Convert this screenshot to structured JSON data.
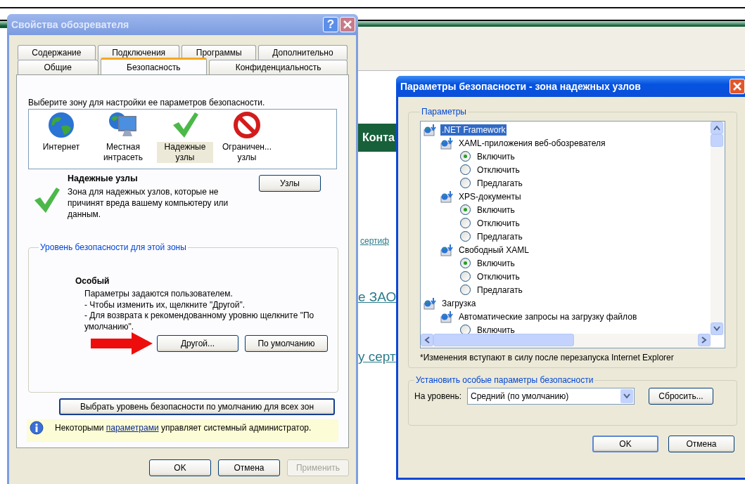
{
  "background_page": {
    "header": "Конта",
    "links": [
      {
        "text": "сертиф",
        "kind": "small"
      },
      {
        "text": "е ЗАО",
        "kind": "large"
      },
      {
        "text": "у серт",
        "kind": "large"
      }
    ]
  },
  "internet_options": {
    "title": "Свойства обозревателя",
    "help_button": "?",
    "tab_rows": [
      [
        {
          "label": "Содержание",
          "selected": false
        },
        {
          "label": "Подключения",
          "selected": false
        },
        {
          "label": "Программы",
          "selected": false
        },
        {
          "label": "Дополнительно",
          "selected": false
        }
      ],
      [
        {
          "label": "Общие",
          "selected": false
        },
        {
          "label": "Безопасность",
          "selected": true
        },
        {
          "label": "Конфиденциальность",
          "selected": false
        }
      ]
    ],
    "zone_prompt": "Выберите зону для настройки ее параметров безопасности.",
    "zones": [
      {
        "kind": "internet",
        "label": "Интернет",
        "selected": false
      },
      {
        "kind": "intranet",
        "label": "Местная интрасеть",
        "selected": false
      },
      {
        "kind": "trusted",
        "label": "Надежные узлы",
        "selected": true
      },
      {
        "kind": "restricted",
        "label": "Ограничен... узлы",
        "selected": false
      }
    ],
    "zone_info": {
      "title": "Надежные узлы",
      "description": "Зона для надежных узлов, которые не причинят вреда вашему компьютеру или данным.",
      "sites_button": "Узлы"
    },
    "level_group": {
      "legend": "Уровень безопасности для этой зоны",
      "level_name": "Особый",
      "lines": [
        "Параметры задаются пользователем.",
        "- Чтобы изменить их, щелкните \"Другой\".",
        "- Для возврата к рекомендованному уровню щелкните \"По умолчанию\"."
      ],
      "custom_button": "Другой...",
      "default_button": "По умолчанию"
    },
    "reset_all_button": "Выбрать уровень безопасности по умолчанию для всех зон",
    "info_bar": {
      "before": "Некоторыми",
      "link": "параметрами",
      "after": "управляет системный администратор."
    },
    "buttons": [
      {
        "label": "OK",
        "disabled": false
      },
      {
        "label": "Отмена",
        "disabled": false
      },
      {
        "label": "Применить",
        "disabled": true
      }
    ]
  },
  "security_settings": {
    "title": "Параметры безопасности - зона надежных узлов",
    "group_legend": "Параметры",
    "tree": [
      {
        "kind": "group",
        "label": ".NET Framework",
        "selected": true,
        "children": [
          {
            "kind": "group",
            "label": "XAML-приложения веб-обозревателя",
            "selected": false,
            "children": [
              {
                "kind": "radio",
                "label": "Включить",
                "checked": true
              },
              {
                "kind": "radio",
                "label": "Отключить",
                "checked": false
              },
              {
                "kind": "radio",
                "label": "Предлагать",
                "checked": false
              }
            ]
          },
          {
            "kind": "group",
            "label": "XPS-документы",
            "selected": false,
            "children": [
              {
                "kind": "radio",
                "label": "Включить",
                "checked": true
              },
              {
                "kind": "radio",
                "label": "Отключить",
                "checked": false
              },
              {
                "kind": "radio",
                "label": "Предлагать",
                "checked": false
              }
            ]
          },
          {
            "kind": "group",
            "label": "Свободный XAML",
            "selected": false,
            "children": [
              {
                "kind": "radio",
                "label": "Включить",
                "checked": true
              },
              {
                "kind": "radio",
                "label": "Отключить",
                "checked": false
              },
              {
                "kind": "radio",
                "label": "Предлагать",
                "checked": false
              }
            ]
          }
        ]
      },
      {
        "kind": "group",
        "label": "Загрузка",
        "selected": false,
        "children": [
          {
            "kind": "group",
            "label": "Автоматические запросы на загрузку файлов",
            "selected": false,
            "children": [
              {
                "kind": "radio",
                "label": "Включить",
                "checked": false
              }
            ]
          }
        ]
      }
    ],
    "note": "*Изменения вступают в силу после перезапуска Internet Explorer",
    "custom_group": {
      "legend": "Установить особые параметры безопасности",
      "level_label": "На уровень:",
      "level_value": "Средний (по умолчанию)",
      "reset_button": "Сбросить..."
    },
    "buttons": [
      {
        "label": "OK",
        "default": true
      },
      {
        "label": "Отмена",
        "default": false
      }
    ]
  }
}
